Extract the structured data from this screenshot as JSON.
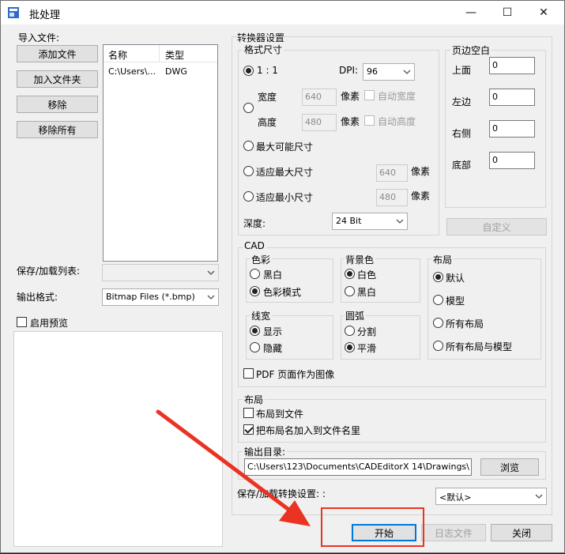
{
  "window": {
    "title": "批处理",
    "minimize": "—",
    "maximize": "☐",
    "close": "✕"
  },
  "import": {
    "group_title": "导入文件:",
    "buttons": {
      "add_file": "添加文件",
      "add_folder": "加入文件夹",
      "remove": "移除",
      "remove_all": "移除所有"
    },
    "columns": [
      "名称",
      "类型"
    ],
    "rows": [
      {
        "name": "C:\\Users\\...",
        "type": "DWG"
      }
    ],
    "save_load_list_label": "保存/加载列表:",
    "save_load_list_value": "",
    "output_format_label": "输出格式:",
    "output_format_value": "Bitmap Files (*.bmp)",
    "enable_preview_label": "启用预览",
    "enable_preview_checked": false
  },
  "converter": {
    "group_title": "转换器设置",
    "format": {
      "title": "格式尺寸",
      "ratio_label": "1 : 1",
      "ratio_selected": true,
      "dpi_label": "DPI:",
      "dpi_value": "96",
      "width_label": "宽度",
      "width_value": "640",
      "height_label": "高度",
      "height_value": "480",
      "pixel_unit": "像素",
      "auto_width_label": "自动宽度",
      "auto_height_label": "自动高度",
      "max_size_label": "最大可能尺寸",
      "fit_max_label": "适应最大尺寸",
      "fit_max_value": "640",
      "fit_min_label": "适应最小尺寸",
      "fit_min_value": "480",
      "depth_label": "深度:",
      "depth_value": "24 Bit"
    },
    "margins": {
      "title": "页边空白",
      "top_label": "上面",
      "top_value": "0",
      "left_label": "左边",
      "left_value": "0",
      "right_label": "右侧",
      "right_value": "0",
      "bottom_label": "底部",
      "bottom_value": "0",
      "custom_button": "自定义"
    },
    "cad": {
      "title": "CAD",
      "color_title": "色彩",
      "color_options": [
        "黑白",
        "色彩模式"
      ],
      "color_selected": 1,
      "bg_title": "背景色",
      "bg_options": [
        "白色",
        "黑白"
      ],
      "bg_selected": 0,
      "layout_title": "布局",
      "layout_options": [
        "默认",
        "模型",
        "所有布局",
        "所有布局与模型"
      ],
      "layout_selected": 0,
      "lw_title": "线宽",
      "lw_options": [
        "显示",
        "隐藏"
      ],
      "lw_selected": 0,
      "arc_title": "圆弧",
      "arc_options": [
        "分割",
        "平滑"
      ],
      "arc_selected": 1,
      "pdf_label": "PDF 页面作为图像",
      "pdf_checked": false
    },
    "layout2": {
      "title": "布局",
      "to_file_label": "布局到文件",
      "to_file_checked": false,
      "add_name_label": "把布局名加入到文件名里",
      "add_name_checked": true
    },
    "output_dir": {
      "title": "输出目录:",
      "value": "C:\\Users\\123\\Documents\\CADEditorX 14\\Drawings\\",
      "browse": "浏览"
    },
    "save_load_settings_label": "保存/加载转换设置: :",
    "save_load_settings_value": "<默认>"
  },
  "footer": {
    "start": "开始",
    "log": "日志文件",
    "close": "关闭"
  },
  "colors": {
    "annotation": "#ea3323",
    "focus": "#0078d7"
  },
  "icons": [
    "batch-app-icon",
    "chevron-down-icon",
    "red-arrow-annotation"
  ]
}
